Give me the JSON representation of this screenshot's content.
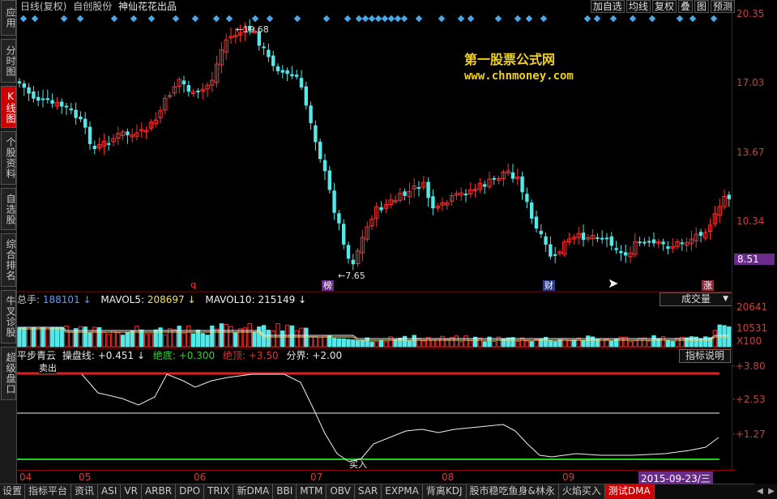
{
  "left_nav": [
    "应用",
    "分时图",
    "K线图",
    "个股资料",
    "自选股",
    "综合排名",
    "牛叉诊股",
    "超级盘口"
  ],
  "left_nav_active": 2,
  "title": {
    "period": "日线(复权)",
    "sector": "自创股份",
    "stock": "神仙花花出品"
  },
  "top_buttons": [
    "加自选",
    "均线",
    "复权",
    "叠",
    "图",
    "预测"
  ],
  "price_axis": [
    "20.35",
    "17.03",
    "13.67",
    "10.34",
    "8.51"
  ],
  "price_annotations": {
    "high": "19.68",
    "low": "7.65"
  },
  "chart_badges": [
    {
      "text": "q",
      "color": "#ff3030"
    },
    {
      "text": "榜",
      "color": "#ffffff",
      "bg": "#6a2c8a"
    },
    {
      "text": "财",
      "color": "#ffffff",
      "bg": "#2a3c8a"
    },
    {
      "text": "涨",
      "color": "#ffffff",
      "bg": "#8a2a3a"
    }
  ],
  "watermark": {
    "line1": "第一股票公式网",
    "line2": "www.chnmoney.com"
  },
  "volume_header": {
    "total_label": "总手:",
    "total_value": "188101",
    "total_arrow": "↓",
    "ma5_label": "MAVOL5:",
    "ma5_value": "208697",
    "ma5_arrow": "↓",
    "ma10_label": "MAVOL10:",
    "ma10_value": "215149",
    "ma10_arrow": "↓"
  },
  "volume_dropdown": "成交量",
  "volume_axis": [
    "20641",
    "10531",
    "X100"
  ],
  "indicator_header": {
    "name": "平步青云",
    "line_label": "操盘线:",
    "line_value": "+0.451",
    "line_arrow": "↓",
    "bottom_label": "绝底:",
    "bottom_value": "+0.300",
    "top_label": "绝顶:",
    "top_value": "+3.50",
    "bound_label": "分界:",
    "bound_value": "+2.00"
  },
  "indicator_button": "指标说明",
  "indicator_axis": [
    "+3.80",
    "+2.53",
    "+1.27"
  ],
  "indicator_signals": {
    "sell": "卖出",
    "buy": "买入"
  },
  "date_axis": [
    "04",
    "05",
    "06",
    "07",
    "08",
    "09"
  ],
  "date_cursor": "2015-09-23/三",
  "bottom_tabs": [
    "设置",
    "指标平台",
    "资讯",
    "ASI",
    "VR",
    "ARBR",
    "DPO",
    "TRIX",
    "新DMA",
    "BBI",
    "MTM",
    "OBV",
    "SAR",
    "EXPMA",
    "背离KDJ",
    "股市稳吃鱼身&林永",
    "火焰买入",
    "测试DMA"
  ],
  "bottom_tabs_active": 17,
  "colors": {
    "up": "#ff3030",
    "down": "#54e8e8",
    "axis": "#c84040",
    "ma": "#f0f0f0",
    "top_line": "#e02020",
    "bottom_line": "#20d020"
  }
}
